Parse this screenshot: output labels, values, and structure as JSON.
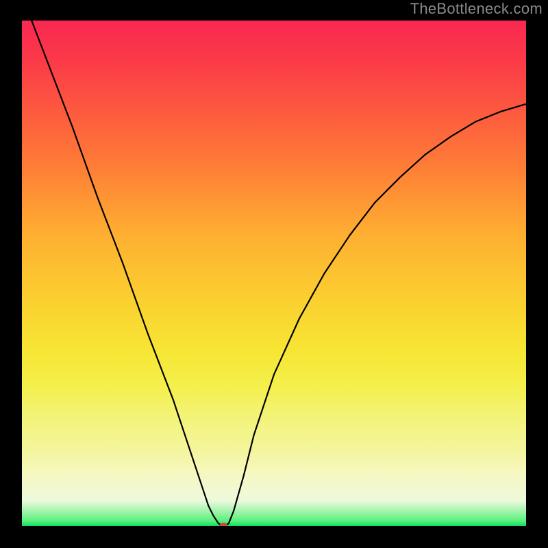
{
  "watermark": "TheBottleneck.com",
  "chart_data": {
    "type": "line",
    "title": "",
    "xlabel": "",
    "ylabel": "",
    "x_range": [
      0,
      1
    ],
    "y_range": [
      0,
      1
    ],
    "series": [
      {
        "name": "bottleneck-curve",
        "x": [
          0.0,
          0.05,
          0.1,
          0.15,
          0.2,
          0.25,
          0.3,
          0.35,
          0.37,
          0.38,
          0.39,
          0.4,
          0.4,
          0.41,
          0.42,
          0.44,
          0.46,
          0.5,
          0.55,
          0.6,
          0.65,
          0.7,
          0.75,
          0.8,
          0.85,
          0.9,
          0.95,
          1.0
        ],
        "y": [
          1.05,
          0.92,
          0.79,
          0.65,
          0.52,
          0.38,
          0.25,
          0.1,
          0.04,
          0.02,
          0.005,
          0.0,
          0.0,
          0.005,
          0.03,
          0.1,
          0.18,
          0.3,
          0.41,
          0.5,
          0.575,
          0.64,
          0.69,
          0.735,
          0.77,
          0.8,
          0.82,
          0.835
        ]
      }
    ],
    "marker": {
      "x": 0.4,
      "y": 0.0
    },
    "gradient_colors": {
      "top": "#f92851",
      "mid": "#f7e533",
      "bottom": "#07e061"
    }
  }
}
